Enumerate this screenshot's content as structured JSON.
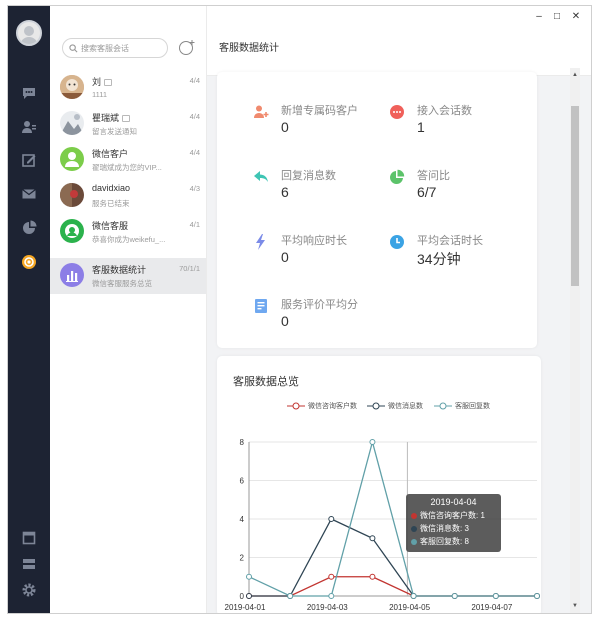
{
  "sidebar": {
    "icons": [
      "chat-icon",
      "contacts-icon",
      "edit-icon",
      "mail-icon",
      "pie-chart-icon",
      "service-icon",
      "window-icon",
      "storage-icon",
      "settings-icon"
    ]
  },
  "sessions": {
    "search_placeholder": "搜索客服会话",
    "items": [
      {
        "name": "刘",
        "sub": "1111",
        "count": "4/4",
        "tag": true
      },
      {
        "name": "瞿瑞斌",
        "sub": "留言发送通知",
        "count": "4/4",
        "tag": true
      },
      {
        "name": "微信客户",
        "sub": "翟瑞斌成为您的VIP...",
        "count": "4/4",
        "tag": false
      },
      {
        "name": "davidxiao",
        "sub": "服务已结束",
        "count": "4/3",
        "tag": false
      },
      {
        "name": "微信客服",
        "sub": "恭喜你成为weikefu_...",
        "count": "4/1",
        "tag": false
      },
      {
        "name": "客服数据统计",
        "sub": "微信客服服务总览",
        "count": "70/1/1",
        "tag": false
      }
    ]
  },
  "window": {
    "minimize": "–",
    "maximize": "□",
    "close": "✕"
  },
  "main": {
    "title": "客服数据统计",
    "stats": [
      {
        "label": "新增专属码客户",
        "value": "0"
      },
      {
        "label": "接入会话数",
        "value": "1"
      },
      {
        "label": "回复消息数",
        "value": "6"
      },
      {
        "label": "答问比",
        "value": "6/7"
      },
      {
        "label": "平均响应时长",
        "value": "0"
      },
      {
        "label": "平均会话时长",
        "value": "34分钟"
      },
      {
        "label": "服务评价平均分",
        "value": "0"
      }
    ]
  },
  "colors": {
    "series_red": "#c23531",
    "series_dark": "#2f4554",
    "series_teal": "#61a0a8"
  },
  "chart_data": {
    "type": "line",
    "title": "客服数据总览",
    "x": [
      "2019-04-01",
      "2019-04-02",
      "2019-04-03",
      "2019-04-04",
      "2019-04-05",
      "2019-04-06",
      "2019-04-07",
      "2019-04-08"
    ],
    "x_ticks": [
      "2019-04-01",
      "2019-04-03",
      "2019-04-05",
      "2019-04-07"
    ],
    "y_ticks": [
      0,
      2,
      4,
      6,
      8
    ],
    "ylim": [
      0,
      8
    ],
    "series": [
      {
        "name": "微信咨询客户数",
        "color": "#c23531",
        "values": [
          0,
          0,
          1,
          1,
          0,
          0,
          0,
          0
        ]
      },
      {
        "name": "微信消息数",
        "color": "#2f4554",
        "values": [
          0,
          0,
          4,
          3,
          0,
          0,
          0,
          0
        ]
      },
      {
        "name": "客服回复数",
        "color": "#61a0a8",
        "values": [
          1,
          0,
          0,
          8,
          0,
          0,
          0,
          0
        ]
      }
    ],
    "tooltip": {
      "title": "2019-04-04",
      "rows": [
        "微信咨询客户数: 1",
        "微信消息数: 3",
        "客服回复数: 8"
      ]
    },
    "grid": true,
    "legend_position": "top"
  }
}
